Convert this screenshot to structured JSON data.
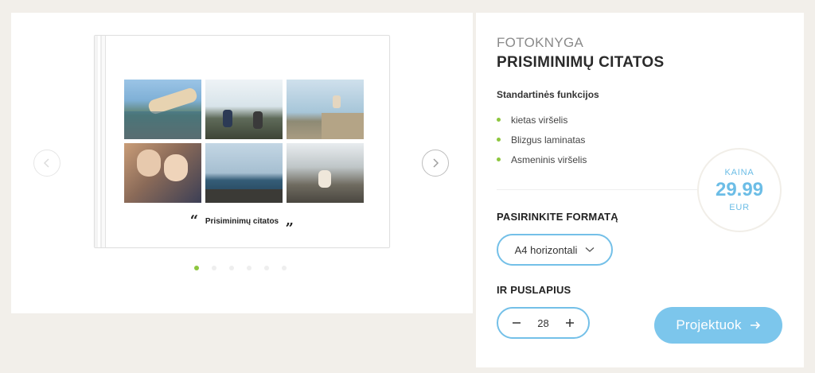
{
  "product": {
    "kind": "FOTOKNYGA",
    "title": "PRISIMINIMŲ CITATOS",
    "caption": "Prisiminimų citatos",
    "quote_open": "“",
    "quote_close": "„",
    "photos": [
      {
        "icon": "photo-feet-car-window"
      },
      {
        "icon": "photo-friends-cheering-hill"
      },
      {
        "icon": "photo-person-sitting-cliff"
      },
      {
        "icon": "photo-two-women-smartphone"
      },
      {
        "icon": "photo-sea-rocks"
      },
      {
        "icon": "photo-woman-mountains"
      }
    ],
    "slides": {
      "count": 6,
      "active": 0
    }
  },
  "features": {
    "heading": "Standartinės funkcijos",
    "items": [
      "kietas viršelis",
      "Blizgus laminatas",
      "Asmeninis viršelis"
    ]
  },
  "price": {
    "label": "KAINA",
    "value": "29.99",
    "currency": "EUR"
  },
  "format": {
    "heading": "PASIRINKITE FORMATĄ",
    "selected": "A4 horizontali"
  },
  "pages": {
    "heading": "IR PUSLAPIUS",
    "value": "28"
  },
  "cta": {
    "label": "Projektuok"
  },
  "colors": {
    "accent_blue": "#74c0e8",
    "button_blue": "#7cc6ec",
    "bullet_green": "#8dc63f",
    "background": "#f2efea"
  },
  "icons": {
    "prev": "chevron-left-icon",
    "next": "chevron-right-icon",
    "dropdown": "chevron-down-icon",
    "minus": "minus-icon",
    "plus": "plus-icon",
    "cta_arrow": "arrow-right-icon"
  }
}
